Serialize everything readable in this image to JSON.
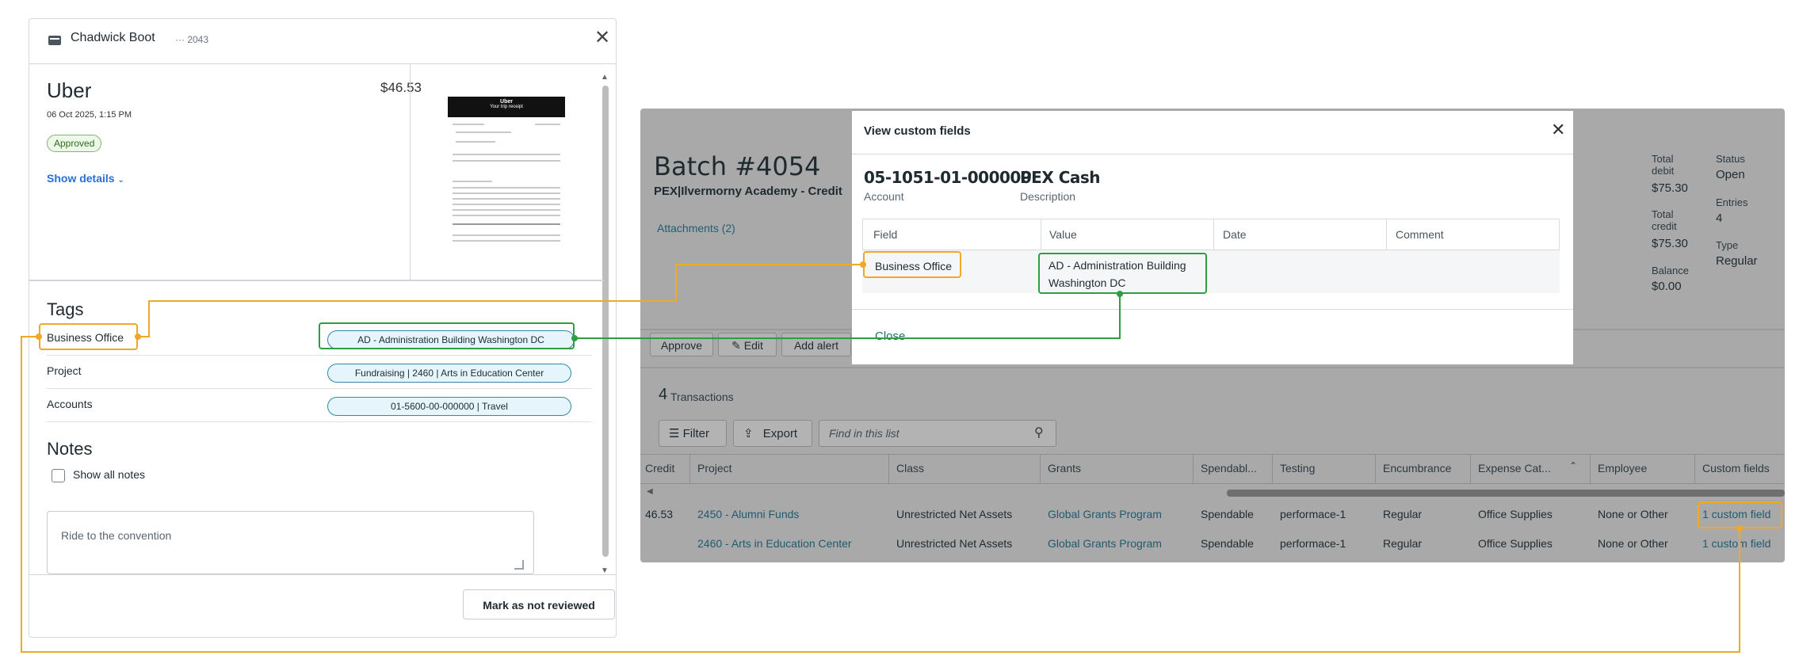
{
  "card": {
    "holder_name": "Chadwick Boot",
    "last4": "··· 2043",
    "merchant": "Uber",
    "amount": "$46.53",
    "datetime": "06 Oct 2025, 1:15 PM",
    "status": "Approved",
    "show_details": "Show details",
    "receipt": {
      "brand": "Uber",
      "heading": "Your trip receipt"
    },
    "tags_title": "Tags",
    "tags": [
      {
        "label": "Business Office",
        "value": "AD - Administration Building Washington DC"
      },
      {
        "label": "Project",
        "value": "Fundraising | 2460 | Arts in Education Center"
      },
      {
        "label": "Accounts",
        "value": "01-5600-00-000000 | Travel"
      }
    ],
    "notes_title": "Notes",
    "show_all_notes": "Show all notes",
    "note_text": "Ride to the convention",
    "mark_button": "Mark as not reviewed"
  },
  "batch": {
    "title": "Batch #4054",
    "subtitle": "PEX|Ilvermorny Academy - Credit",
    "attachments": "Attachments (2)",
    "actions": [
      "Approve",
      "Edit",
      "Add alert"
    ],
    "summary": [
      {
        "label": "Total debit",
        "value": "$75.30"
      },
      {
        "label": "Total credit",
        "value": "$75.30"
      },
      {
        "label": "Balance",
        "value": "$0.00"
      },
      {
        "label": "Status",
        "value": "Open"
      },
      {
        "label": "Entries",
        "value": "4"
      },
      {
        "label": "Type",
        "value": "Regular"
      }
    ],
    "transactions_count": "4",
    "transactions_label": "Transactions",
    "filter_label": "Filter",
    "export_label": "Export",
    "search_placeholder": "Find in this list",
    "columns": [
      "Credit",
      "Project",
      "Class",
      "Grants",
      "Spendabl...",
      "Testing",
      "Encumbrance",
      "Expense Cat...",
      "Employee",
      "Custom fields"
    ],
    "rows": [
      {
        "credit": "46.53",
        "project": "2450 - Alumni Funds",
        "class": "Unrestricted Net Assets",
        "grants": "Global Grants Program",
        "spendable": "Spendable",
        "testing": "performace-1",
        "encumbrance": "Regular",
        "expense": "Office Supplies",
        "employee": "None or Other",
        "custom": "1 custom field"
      },
      {
        "credit": "",
        "project": "2460 - Arts in Education Center",
        "class": "Unrestricted Net Assets",
        "grants": "Global Grants Program",
        "spendable": "Spendable",
        "testing": "performace-1",
        "encumbrance": "Regular",
        "expense": "Office Supplies",
        "employee": "None or Other",
        "custom": "1 custom field"
      }
    ]
  },
  "modal": {
    "title": "View custom fields",
    "account": "05-1051-01-000000",
    "account_label": "Account",
    "description": "PEX Cash",
    "description_label": "Description",
    "columns": [
      "Field",
      "Value",
      "Date",
      "Comment"
    ],
    "row": {
      "field": "Business Office",
      "value_line1": "AD - Administration Building",
      "value_line2": "Washington DC",
      "date": "",
      "comment": ""
    },
    "close_link": "Close"
  },
  "colors": {
    "highlight_orange": "#f0a826",
    "highlight_green": "#2e9d43",
    "link_blue": "#2a6fd6",
    "pill_border": "#2f8aa8"
  },
  "icons": [
    "card-icon",
    "close-icon",
    "chevron-down-icon",
    "checkbox-icon",
    "pencil-icon",
    "filter-icon",
    "export-icon",
    "search-icon",
    "sort-up-icon"
  ]
}
